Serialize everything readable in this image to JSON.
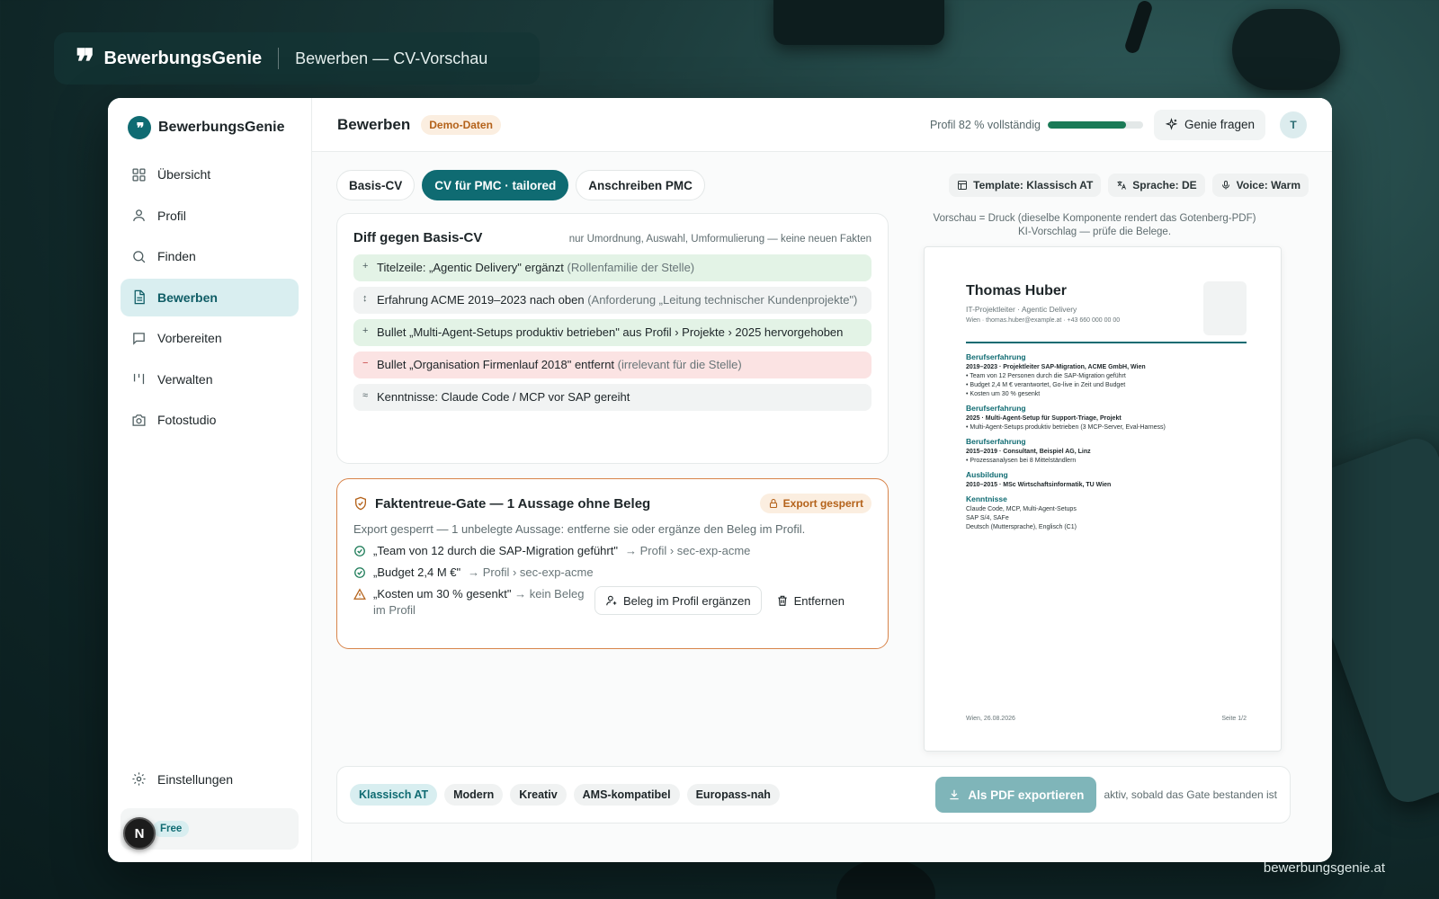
{
  "header": {
    "brand": "BewerbungsGenie",
    "breadcrumb": "Bewerben — CV-Vorschau"
  },
  "footer_domain": "bewerbungsgenie.at",
  "sidebar": {
    "brand": "BewerbungsGenie",
    "items": [
      {
        "label": "Übersicht",
        "icon": "grid-icon"
      },
      {
        "label": "Profil",
        "icon": "user-icon"
      },
      {
        "label": "Finden",
        "icon": "search-icon"
      },
      {
        "label": "Bewerben",
        "icon": "document-icon",
        "active": true
      },
      {
        "label": "Vorbereiten",
        "icon": "chat-icon"
      },
      {
        "label": "Verwalten",
        "icon": "kanban-icon"
      },
      {
        "label": "Fotostudio",
        "icon": "camera-icon"
      }
    ],
    "settings": "Einstellungen",
    "plan_badge": "Free",
    "avatar_letter": "N"
  },
  "topbar": {
    "title": "Bewerben",
    "badge": "Demo-Daten",
    "progress_label": "Profil 82 % vollständig",
    "progress_value": 0.82,
    "genie_button": "Genie fragen",
    "avatar_letter": "T"
  },
  "tabs": [
    {
      "label": "Basis-CV",
      "active": false
    },
    {
      "label": "CV für PMC · tailored",
      "active": true
    },
    {
      "label": "Anschreiben PMC",
      "active": false
    }
  ],
  "meta_chips": {
    "template": "Template: Klassisch AT",
    "language": "Sprache: DE",
    "voice": "Voice: Warm"
  },
  "diff": {
    "title": "Diff gegen Basis-CV",
    "note": "nur Umordnung, Auswahl, Umformulierung — keine neuen Fakten",
    "rows": [
      {
        "kind": "add",
        "symbol": "+",
        "text": "Titelzeile: „Agentic Delivery\" ergänzt",
        "dim": "(Rollenfamilie der Stelle)"
      },
      {
        "kind": "move",
        "symbol": "↕",
        "text": "Erfahrung ACME 2019–2023 nach oben",
        "dim": "(Anforderung „Leitung technischer Kundenprojekte\")"
      },
      {
        "kind": "add",
        "symbol": "+",
        "text": "Bullet „Multi-Agent-Setups produktiv betrieben\" aus Profil › Projekte › 2025 hervorgehoben",
        "dim": ""
      },
      {
        "kind": "rem",
        "symbol": "−",
        "text": "Bullet „Organisation Firmenlauf 2018\" entfernt",
        "dim": "(irrelevant für die Stelle)"
      },
      {
        "kind": "chg",
        "symbol": "≈",
        "text": "Kenntnisse: Claude Code / MCP vor SAP gereiht",
        "dim": ""
      }
    ]
  },
  "gate": {
    "title": "Faktentreue-Gate — 1 Aussage ohne Beleg",
    "badge": "Export gesperrt",
    "description": "Export gesperrt — 1 unbelegte Aussage: entferne sie oder ergänze den Beleg im Profil.",
    "ok_items": [
      {
        "text": "„Team von 12 durch die SAP-Migration geführt\"",
        "ref": "→ Profil › sec-exp-acme"
      },
      {
        "text": "„Budget 2,4 M €\"",
        "ref": "→ Profil › sec-exp-acme"
      }
    ],
    "warn_item": {
      "text": "„Kosten um 30 % gesenkt\"",
      "ref": "→ kein Beleg im Profil"
    },
    "add_evidence_button": "Beleg im Profil ergänzen",
    "remove_button": "Entfernen"
  },
  "preview": {
    "caption_line1": "Vorschau = Druck (dieselbe Komponente rendert das Gotenberg-PDF)",
    "caption_line2": "KI-Vorschlag — prüfe die Belege."
  },
  "cv": {
    "name": "Thomas Huber",
    "role": "IT-Projektleiter · Agentic Delivery",
    "contact": "Wien · thomas.huber@example.at · +43 660 000 00 00",
    "sections": {
      "s1_title": "Berufserfahrung",
      "s1_entry": "2019–2023 · Projektleiter SAP-Migration, ACME GmbH, Wien",
      "s1_b1": "• Team von 12 Personen durch die SAP-Migration geführt",
      "s1_b2": "• Budget 2,4 M € verantwortet, Go-live in Zeit und Budget",
      "s1_b3": "• Kosten um 30 % gesenkt",
      "s2_title": "Berufserfahrung",
      "s2_entry": "2025 · Multi-Agent-Setup für Support-Triage, Projekt",
      "s2_b1": "• Multi-Agent-Setups produktiv betrieben (3 MCP-Server, Eval-Harness)",
      "s3_title": "Berufserfahrung",
      "s3_entry": "2015–2019 · Consultant, Beispiel AG, Linz",
      "s3_b1": "• Prozessanalysen bei 8 Mittelständlern",
      "s4_title": "Ausbildung",
      "s4_entry": "2010–2015 · MSc Wirtschaftsinformatik, TU Wien",
      "s5_title": "Kenntnisse",
      "s5_l1": "Claude Code, MCP, Multi-Agent-Setups",
      "s5_l2": "SAP S/4, SAFe",
      "s5_l3": "Deutsch (Muttersprache), Englisch (C1)"
    },
    "footer_left": "Wien, 26.08.2026",
    "footer_right": "Seite 1/2"
  },
  "export_bar": {
    "templates": [
      {
        "label": "Klassisch AT",
        "active": true
      },
      {
        "label": "Modern",
        "active": false
      },
      {
        "label": "Kreativ",
        "active": false
      },
      {
        "label": "AMS-kompatibel",
        "active": false
      },
      {
        "label": "Europass-nah",
        "active": false
      }
    ],
    "export_button": "Als PDF exportieren",
    "note": "aktiv, sobald das Gate bestanden ist"
  },
  "colors": {
    "accent": "#0f6b72",
    "warning": "#b4621a",
    "success": "#1a7a56",
    "danger": "#c43c3c"
  }
}
